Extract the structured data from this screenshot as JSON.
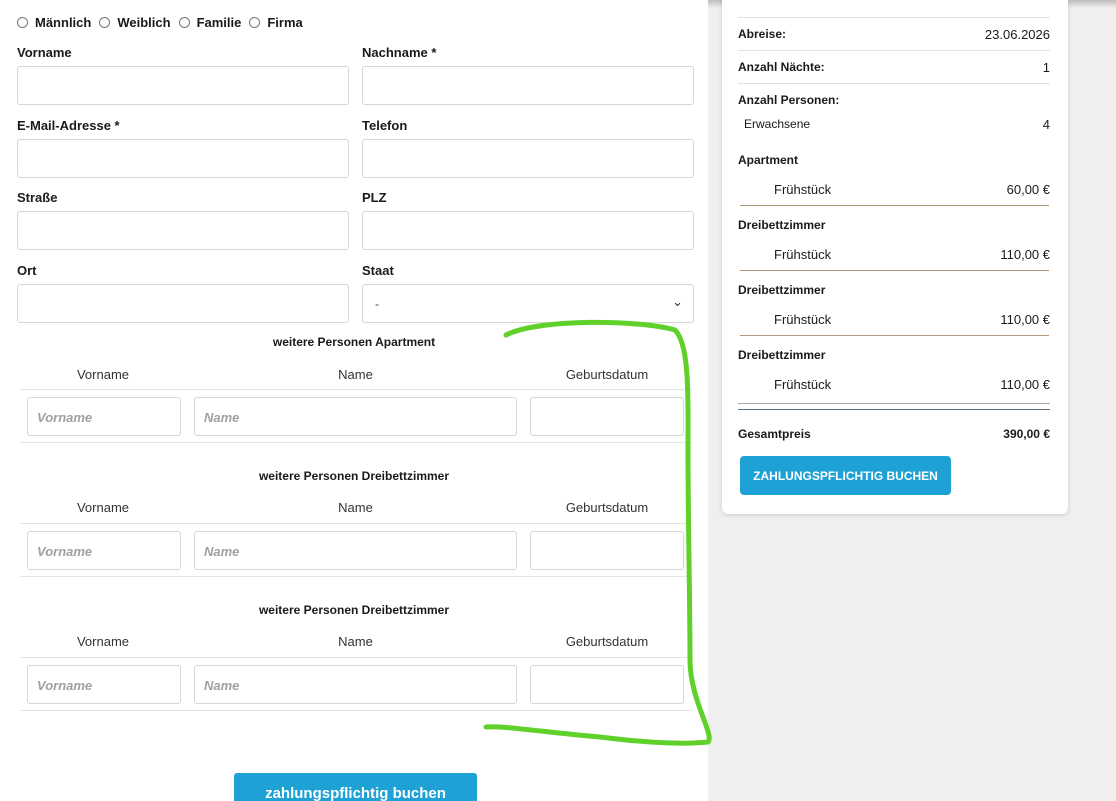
{
  "form": {
    "salutations": [
      "Männlich",
      "Weiblich",
      "Familie",
      "Firma"
    ],
    "first_name_label": "Vorname",
    "last_name_label": "Nachname *",
    "email_label": "E-Mail-Adresse *",
    "phone_label": "Telefon",
    "street_label": "Straße",
    "zip_label": "PLZ",
    "city_label": "Ort",
    "country_label": "Staat",
    "country_value": "-"
  },
  "persons": [
    {
      "title": "weitere Personen Apartment",
      "col_first": "Vorname",
      "col_name": "Name",
      "col_birth": "Geburtsdatum",
      "ph_first": "Vorname",
      "ph_name": "Name"
    },
    {
      "title": "weitere Personen Dreibettzimmer",
      "col_first": "Vorname",
      "col_name": "Name",
      "col_birth": "Geburtsdatum",
      "ph_first": "Vorname",
      "ph_name": "Name"
    },
    {
      "title": "weitere Personen Dreibettzimmer",
      "col_first": "Vorname",
      "col_name": "Name",
      "col_birth": "Geburtsdatum",
      "ph_first": "Vorname",
      "ph_name": "Name"
    }
  ],
  "bottom_button": "zahlungspflichtig buchen",
  "summary": {
    "departure_label": "Abreise:",
    "departure_value": "23.06.2026",
    "nights_label": "Anzahl Nächte:",
    "nights_value": "1",
    "persons_label": "Anzahl Personen:",
    "adults_label": "Erwachsene",
    "adults_value": "4",
    "rooms": [
      {
        "name": "Apartment",
        "item": "Frühstück",
        "price": "60,00 €"
      },
      {
        "name": "Dreibettzimmer",
        "item": "Frühstück",
        "price": "110,00 €"
      },
      {
        "name": "Dreibettzimmer",
        "item": "Frühstück",
        "price": "110,00 €"
      },
      {
        "name": "Dreibettzimmer",
        "item": "Frühstück",
        "price": "110,00 €"
      }
    ],
    "total_label": "Gesamtpreis",
    "total_value": "390,00 €",
    "book_button": "ZAHLUNGSPFLICHTIG BUCHEN"
  },
  "colors": {
    "accent": "#1ea1d4",
    "annotation": "#5fd12a",
    "divider": "#b39a7d"
  }
}
